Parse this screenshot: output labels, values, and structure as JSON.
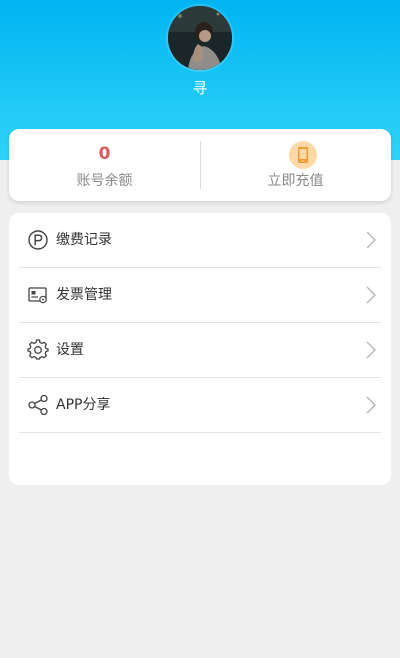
{
  "header": {
    "username": "寻"
  },
  "balance": {
    "value": "0",
    "label": "账号余额",
    "recharge_label": "立即充值"
  },
  "menu": {
    "items": [
      {
        "label": "缴费记录",
        "icon": "parking-icon"
      },
      {
        "label": "发票管理",
        "icon": "invoice-icon"
      },
      {
        "label": "设置",
        "icon": "gear-icon"
      },
      {
        "label": "APP分享",
        "icon": "share-icon"
      }
    ]
  },
  "colors": {
    "header_top": "#00b4f2",
    "header_bottom": "#2fd2f8",
    "balance_value": "#e0585c",
    "recharge_icon_bg": "#fcd9a6",
    "recharge_icon_fg": "#f29b2e",
    "page_bg": "#efefef"
  }
}
